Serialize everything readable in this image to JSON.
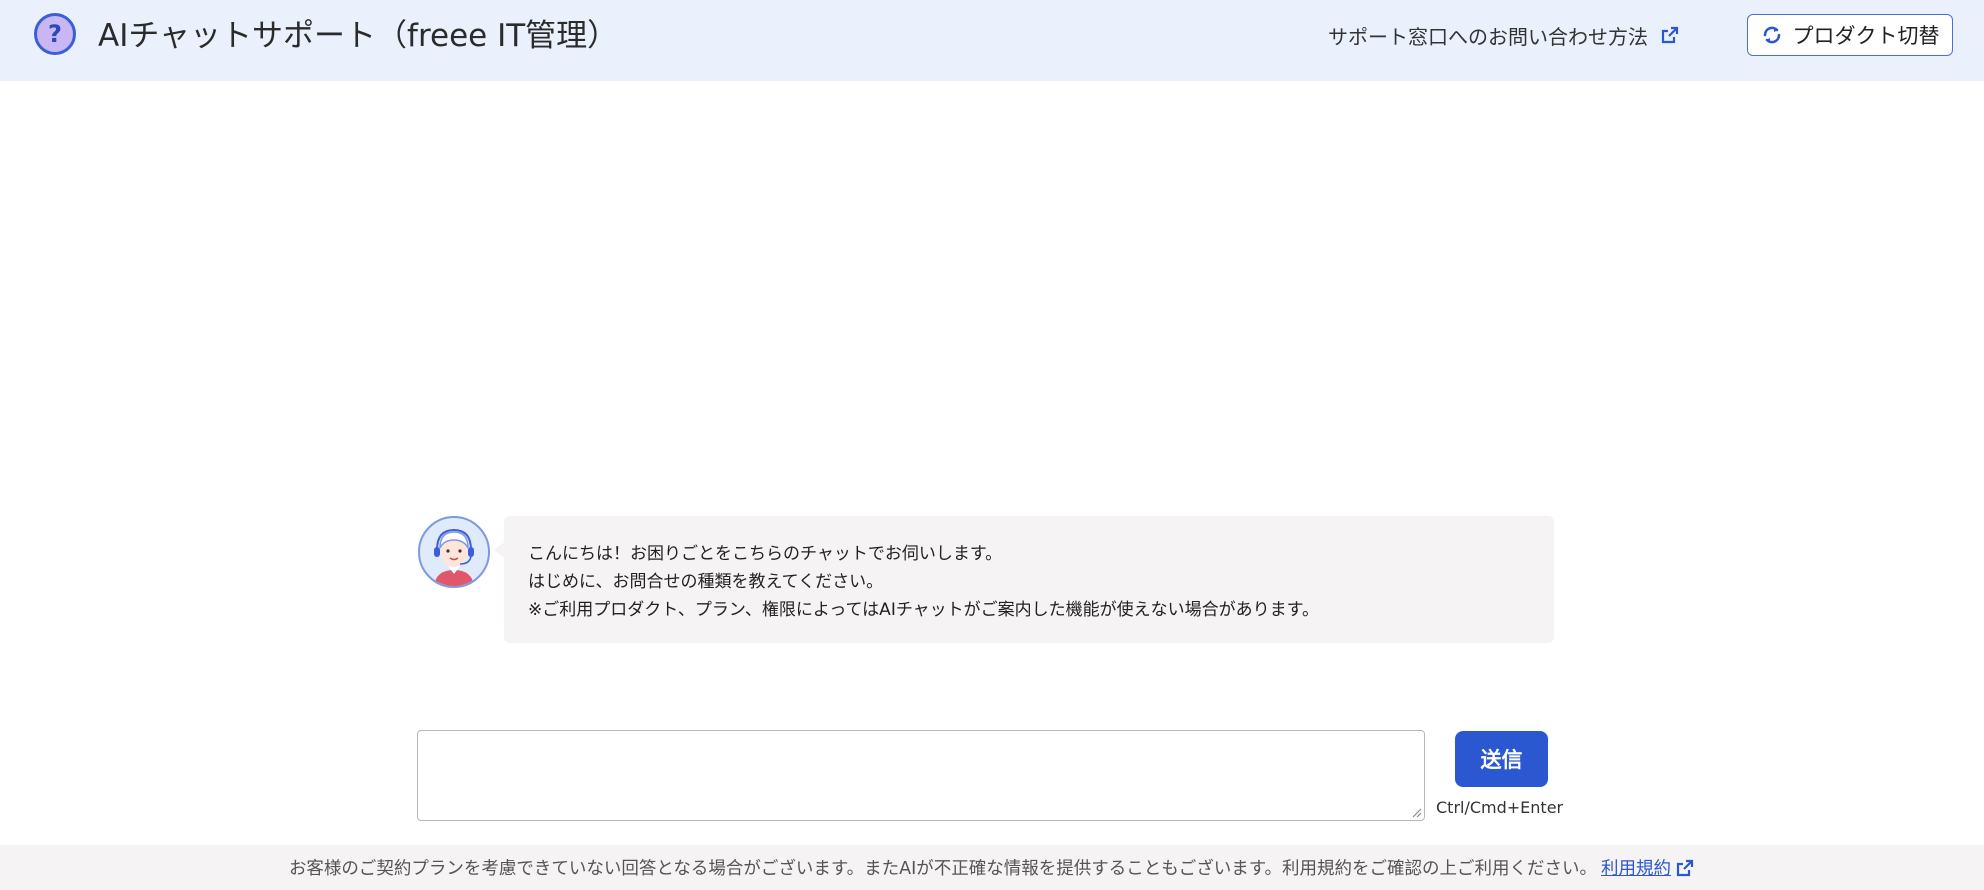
{
  "header": {
    "help_icon_glyph": "?",
    "title": "AIチャットサポート（freee IT管理）",
    "support_link_label": "サポート窓口へのお問い合わせ方法",
    "switch_product_label": "プロダクト切替"
  },
  "chat": {
    "messages": [
      {
        "sender": "assistant",
        "lines": [
          "こんにちは！お困りごとをこちらのチャットでお伺いします。",
          "はじめに、お問合せの種類を教えてください。",
          "※ご利用プロダクト、プラン、権限によってはAIチャットがご案内した機能が使えない場合があります。"
        ]
      }
    ]
  },
  "composer": {
    "value": "",
    "send_label": "送信",
    "shortcut_hint": "Ctrl/Cmd+Enter"
  },
  "footer": {
    "disclaimer": "お客様のご契約プランを考慮できていない回答となる場合がございます。またAIが不正確な情報を提供することもございます。利用規約をご確認の上ご利用ください。",
    "terms_link_label": "利用規約"
  },
  "colors": {
    "header_bg": "#eaf1fd",
    "accent_blue": "#2b57d0",
    "bubble_bg": "#f5f3f3",
    "help_badge_fill": "#c9b6f4"
  },
  "icons": {
    "help": "question-circle-icon",
    "external_link": "external-link-icon",
    "switch": "refresh-icon",
    "avatar": "support-agent-avatar"
  }
}
